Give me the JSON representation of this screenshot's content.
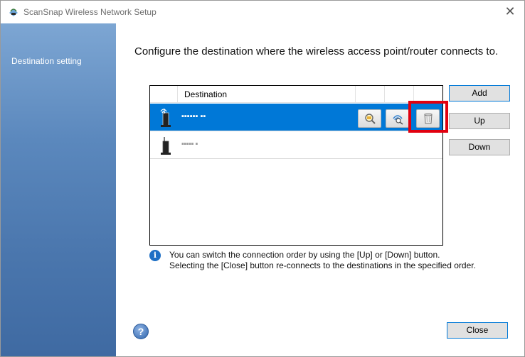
{
  "window": {
    "title": "ScanSnap Wireless Network Setup",
    "close_glyph": "✕"
  },
  "sidebar": {
    "items": [
      {
        "label": "Destination setting",
        "active": true
      }
    ]
  },
  "main": {
    "instruction": "Configure the destination where the wireless access point/router connects to.",
    "list": {
      "header": "Destination",
      "rows": [
        {
          "name": "▪▪▪▪▪▪ ▪▪",
          "selected": true,
          "icon": "router-active-icon",
          "actions": [
            "properties-icon",
            "connection-icon",
            "trash-icon"
          ]
        },
        {
          "name": "▪▪▪▪▪ ▪",
          "selected": false,
          "icon": "router-icon"
        }
      ]
    },
    "side_buttons": {
      "add": "Add",
      "up": "Up",
      "down": "Down"
    },
    "info": {
      "line1": "You can switch the connection order by using the [Up] or [Down] button.",
      "line2": "Selecting the [Close] button re-connects to the destinations in the specified order."
    },
    "footer": {
      "close": "Close",
      "help_glyph": "?"
    }
  },
  "colors": {
    "selection": "#0078d7",
    "highlight": "#e1000f",
    "sidebar": "#4a76ad"
  }
}
